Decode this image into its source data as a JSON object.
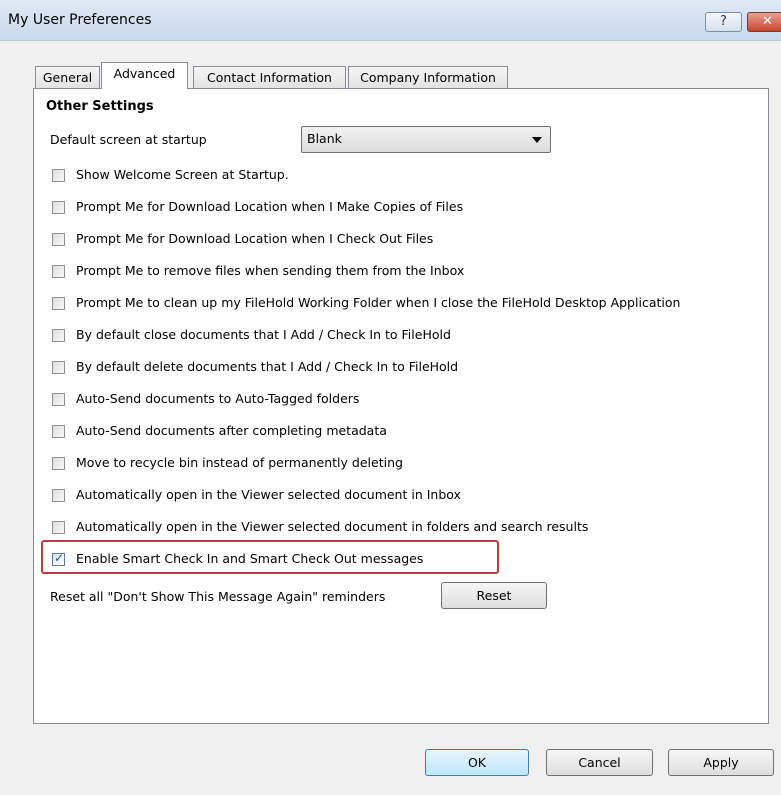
{
  "window": {
    "title": "My User Preferences",
    "help_label": "?",
    "close_label": "✕"
  },
  "tabs": [
    {
      "label": "General",
      "active": false
    },
    {
      "label": "Advanced",
      "active": true
    },
    {
      "label": "Contact Information",
      "active": false
    },
    {
      "label": "Company Information",
      "active": false
    }
  ],
  "settings": {
    "section_title": "Other Settings",
    "startup_label": "Default screen at startup",
    "startup_value": "Blank",
    "options": [
      {
        "label": "Show Welcome Screen at Startup.",
        "checked": false
      },
      {
        "label": "Prompt Me for Download Location when I Make Copies of Files",
        "checked": false
      },
      {
        "label": "Prompt Me for Download Location when I Check Out Files",
        "checked": false
      },
      {
        "label": "Prompt Me to remove files when sending them from the Inbox",
        "checked": false
      },
      {
        "label": "Prompt Me to clean up my FileHold Working Folder when I close the FileHold Desktop Application",
        "checked": false
      },
      {
        "label": "By default close documents that I Add / Check In to FileHold",
        "checked": false
      },
      {
        "label": "By default delete documents that I Add / Check In to FileHold",
        "checked": false
      },
      {
        "label": "Auto-Send documents to Auto-Tagged folders",
        "checked": false
      },
      {
        "label": "Auto-Send documents after completing metadata",
        "checked": false
      },
      {
        "label": "Move to recycle bin instead of permanently deleting",
        "checked": false
      },
      {
        "label": "Automatically open in the Viewer selected document in Inbox",
        "checked": false
      },
      {
        "label": "Automatically open in the Viewer selected document in folders and search results",
        "checked": false
      },
      {
        "label": "Enable Smart Check In and Smart Check Out messages",
        "checked": true
      }
    ],
    "reset_label": "Reset all \"Don't Show This Message Again\" reminders",
    "reset_button": "Reset"
  },
  "footer": {
    "ok": "OK",
    "cancel": "Cancel",
    "apply": "Apply"
  },
  "colors": {
    "highlight": "#c8373d"
  }
}
